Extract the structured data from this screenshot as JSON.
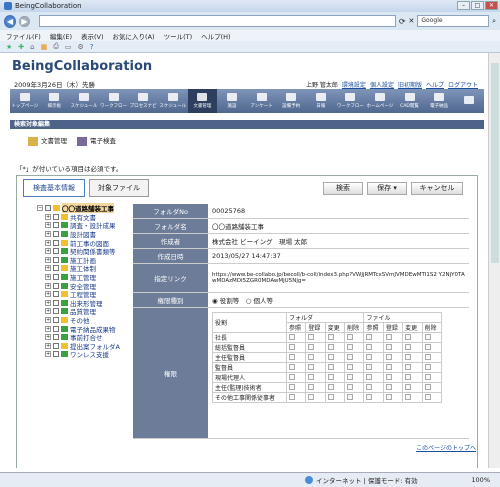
{
  "window": {
    "title": "BeingCollaboration"
  },
  "browser": {
    "url": "",
    "search_placeholder": "Google",
    "menu": [
      "ファイル(F)",
      "編集(E)",
      "表示(V)",
      "お気に入り(A)",
      "ツール(T)",
      "ヘルプ(H)"
    ]
  },
  "header": {
    "logo": "BeingCollaboration",
    "date": "2009年3月26日（木）先勝",
    "user": "上野 管太郎",
    "links": [
      "環境設定",
      "個人設定",
      "旧初期版",
      "ヘルプ",
      "ログアウト"
    ]
  },
  "nav": [
    {
      "label": "トップページ"
    },
    {
      "label": "掲示板"
    },
    {
      "label": "スケジュール"
    },
    {
      "label": "ワークフロー"
    },
    {
      "label": "プロセスナビ"
    },
    {
      "label": "スケジュール"
    },
    {
      "label": "文書管理",
      "active": true
    },
    {
      "label": "施設"
    },
    {
      "label": "アンケート"
    },
    {
      "label": "設備予約"
    },
    {
      "label": "日報"
    },
    {
      "label": "ワークフロー"
    },
    {
      "label": "ホームページ"
    },
    {
      "label": "CAD閲覧"
    },
    {
      "label": "電子納品"
    },
    {
      "label": ""
    }
  ],
  "section_title": "検索対象編集",
  "subtabs": [
    "文書管理",
    "電子検査"
  ],
  "required_note": "「*」が付いている項目は必須です。",
  "panel": {
    "tab_basic": "検査基本情報",
    "tab_files": "対象ファイル",
    "btn_search": "検索",
    "btn_save": "保存 ▾",
    "btn_cancel": "キャンセル"
  },
  "tree": [
    {
      "label": "〇〇道路舗装工事",
      "level": 0,
      "selected": true,
      "checked": true
    },
    {
      "label": "共有文書",
      "level": 1
    },
    {
      "label": "調査・設計成果",
      "level": 1
    },
    {
      "label": "設計図書",
      "level": 1
    },
    {
      "label": "前工事の図面",
      "level": 1
    },
    {
      "label": "契約関係書類等",
      "level": 1
    },
    {
      "label": "施工計画",
      "level": 1
    },
    {
      "label": "施工体制",
      "level": 1
    },
    {
      "label": "施工管理",
      "level": 1
    },
    {
      "label": "安全管理",
      "level": 1
    },
    {
      "label": "工程管理",
      "level": 1
    },
    {
      "label": "出来形管理",
      "level": 1
    },
    {
      "label": "品質管理",
      "level": 1
    },
    {
      "label": "その他",
      "level": 1
    },
    {
      "label": "電子納品成果物",
      "level": 1
    },
    {
      "label": "事前打合せ",
      "level": 1
    },
    {
      "label": "提出案フォルダA",
      "level": 1
    },
    {
      "label": "ワンレス支援",
      "level": 1
    }
  ],
  "fields": [
    {
      "key": "フォルダNo",
      "value": "00025768"
    },
    {
      "key": "フォルダ名",
      "value": "〇〇道路舗装工事"
    },
    {
      "key": "作成者",
      "value": "株式会社 ビーイング　現場 太郎"
    },
    {
      "key": "作成日時",
      "value": "2013/05/27 14:47:37"
    },
    {
      "key": "指定リンク",
      "value": "https://www.be-collabo.jp/becoll/b-coll/index3.php?VWJjRMTcxSVmJVMDEwMTI1S2 Y2NjY0TAwMDAzMDI5ZGR0MDAwMjU5Njg="
    },
    {
      "key": "権限種別",
      "value": ""
    }
  ],
  "perm_type": {
    "option1": "役割等",
    "option2": "個人等",
    "selected": "役割等"
  },
  "perm_table": {
    "key": "権限",
    "head_role": "役割",
    "group_folder": "フォルダ",
    "group_file": "ファイル",
    "cols": [
      "参照",
      "登録",
      "変更",
      "削除",
      "参照",
      "登録",
      "変更",
      "削除"
    ],
    "rows": [
      "社長",
      "総括監督員",
      "主任監督員",
      "監督員",
      "現場代理人",
      "主任(監理)技術者",
      "その他工事関係従事者"
    ]
  },
  "footer_link": "このページのトップへ",
  "status": {
    "zone": "インターネット | 保護モード: 有効",
    "zoom": "100%"
  }
}
